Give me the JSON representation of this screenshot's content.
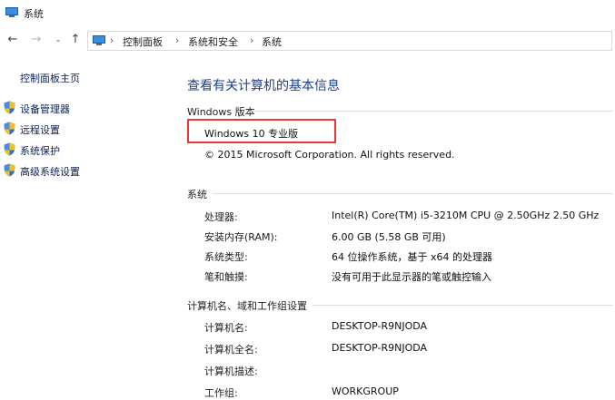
{
  "window": {
    "title": "系统"
  },
  "nav": {
    "back": "←",
    "forward": "→",
    "recent": "⌄",
    "up": "↑"
  },
  "breadcrumb": {
    "items": [
      "控制面板",
      "系统和安全",
      "系统"
    ],
    "separator": "›"
  },
  "sidebar": {
    "home_link": "控制面板主页",
    "items": [
      {
        "label": "设备管理器",
        "icon": "shield-icon"
      },
      {
        "label": "远程设置",
        "icon": "shield-icon"
      },
      {
        "label": "系统保护",
        "icon": "shield-icon"
      },
      {
        "label": "高级系统设置",
        "icon": "shield-icon"
      }
    ]
  },
  "main": {
    "title": "查看有关计算机的基本信息",
    "windows_section": {
      "label": "Windows 版本",
      "edition": "Windows 10 专业版",
      "copyright": "© 2015 Microsoft Corporation. All rights reserved."
    },
    "system_section": {
      "label": "系统",
      "rows": [
        {
          "label": "处理器:",
          "value": "Intel(R) Core(TM) i5-3210M CPU @ 2.50GHz   2.50 GHz"
        },
        {
          "label": "安装内存(RAM):",
          "value": "6.00 GB (5.58 GB 可用)"
        },
        {
          "label": "系统类型:",
          "value": "64 位操作系统，基于 x64 的处理器"
        },
        {
          "label": "笔和触摸:",
          "value": "没有可用于此显示器的笔或触控输入"
        }
      ]
    },
    "computer_section": {
      "label": "计算机名、域和工作组设置",
      "rows": [
        {
          "label": "计算机名:",
          "value": "DESKTOP-R9NJODA"
        },
        {
          "label": "计算机全名:",
          "value": "DESKTOP-R9NJODA"
        },
        {
          "label": "计算机描述:",
          "value": ""
        },
        {
          "label": "工作组:",
          "value": "WORKGROUP"
        }
      ]
    }
  },
  "colors": {
    "title_blue": "#1e3f8c",
    "link_navy": "#0b1f55",
    "highlight_red": "#e53935"
  }
}
